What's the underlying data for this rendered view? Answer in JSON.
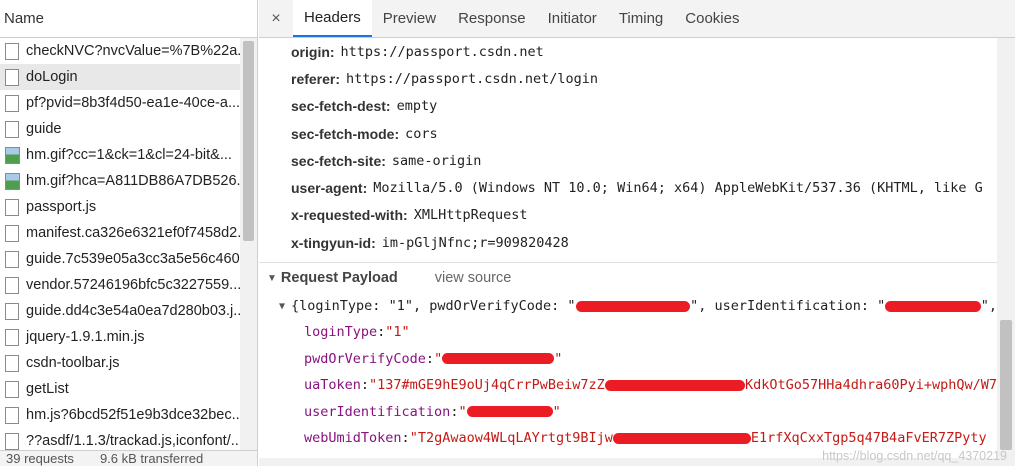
{
  "left_panel": {
    "header": "Name",
    "requests": [
      {
        "name": "checkNVC?nvcValue=%7B%22a...",
        "icon": "document-icon"
      },
      {
        "name": "doLogin",
        "icon": "document-icon",
        "selected": true
      },
      {
        "name": "pf?pvid=8b3f4d50-ea1e-40ce-a...",
        "icon": "document-icon"
      },
      {
        "name": "guide",
        "icon": "document-icon"
      },
      {
        "name": "hm.gif?cc=1&ck=1&cl=24-bit&...",
        "icon": "image-icon"
      },
      {
        "name": "hm.gif?hca=A811DB86A7DB526...",
        "icon": "image-icon"
      },
      {
        "name": "passport.js",
        "icon": "document-icon"
      },
      {
        "name": "manifest.ca326e6321ef0f7458d2...",
        "icon": "document-icon"
      },
      {
        "name": "guide.7c539e05a3cc3a5e56c460...",
        "icon": "document-icon"
      },
      {
        "name": "vendor.57246196bfc5c3227559...",
        "icon": "document-icon"
      },
      {
        "name": "guide.dd4c3e54a0ea7d280b03.j...",
        "icon": "document-icon"
      },
      {
        "name": "jquery-1.9.1.min.js",
        "icon": "document-icon"
      },
      {
        "name": "csdn-toolbar.js",
        "icon": "document-icon"
      },
      {
        "name": "getList",
        "icon": "document-icon"
      },
      {
        "name": "hm.js?6bcd52f51e9b3dce32bec...",
        "icon": "document-icon"
      },
      {
        "name": "??asdf/1.1.3/trackad.js,iconfont/...",
        "icon": "document-icon"
      }
    ],
    "footer": {
      "requests": "39 requests",
      "transferred": "9.6 kB transferred"
    }
  },
  "tabs": {
    "close": "×",
    "items": [
      "Headers",
      "Preview",
      "Response",
      "Initiator",
      "Timing",
      "Cookies"
    ],
    "active": "Headers"
  },
  "headers": [
    {
      "key": "origin:",
      "value": "https://passport.csdn.net"
    },
    {
      "key": "referer:",
      "value": "https://passport.csdn.net/login"
    },
    {
      "key": "sec-fetch-dest:",
      "value": "empty"
    },
    {
      "key": "sec-fetch-mode:",
      "value": "cors"
    },
    {
      "key": "sec-fetch-site:",
      "value": "same-origin"
    },
    {
      "key": "user-agent:",
      "value": "Mozilla/5.0 (Windows NT 10.0; Win64; x64) AppleWebKit/537.36 (KHTML, like G"
    },
    {
      "key": "x-requested-with:",
      "value": "XMLHttpRequest"
    },
    {
      "key": "x-tingyun-id:",
      "value": "im-pGljNfnc;r=909820428"
    }
  ],
  "payload": {
    "title": "Request Payload",
    "view_source": "view source",
    "summary": {
      "open": "{loginType: \"1\", pwdOrVerifyCode: \"",
      "mid": "\", userIdentification: \"",
      "end": "\","
    },
    "fields": [
      {
        "key": "loginType",
        "value_pre": "\"1\"",
        "value_post": ""
      },
      {
        "key": "pwdOrVerifyCode",
        "value_pre": "\"",
        "value_post": "\""
      },
      {
        "key": "uaToken",
        "value_pre": "\"137#mGE9hE9oUj4qCrrPwBeiw7zZ",
        "value_post": "KdkOtGo57HHa4dhra60Pyi+wphQw/W7"
      },
      {
        "key": "userIdentification",
        "value_pre": "\"",
        "value_post": "\""
      },
      {
        "key": "webUmidToken",
        "value_pre": "\"T2gAwaow4WLqLAYrtgt9BIjw",
        "value_post": "E1rfXqCxxTgp5q47B4aFvER7ZPyty"
      }
    ],
    "colon": ": "
  },
  "watermark": "https://blog.csdn.net/qq_4370219",
  "colors": {
    "accent": "#1a73e8",
    "key": "#881280",
    "string": "#c41a16",
    "redaction": "#ec1c24"
  }
}
